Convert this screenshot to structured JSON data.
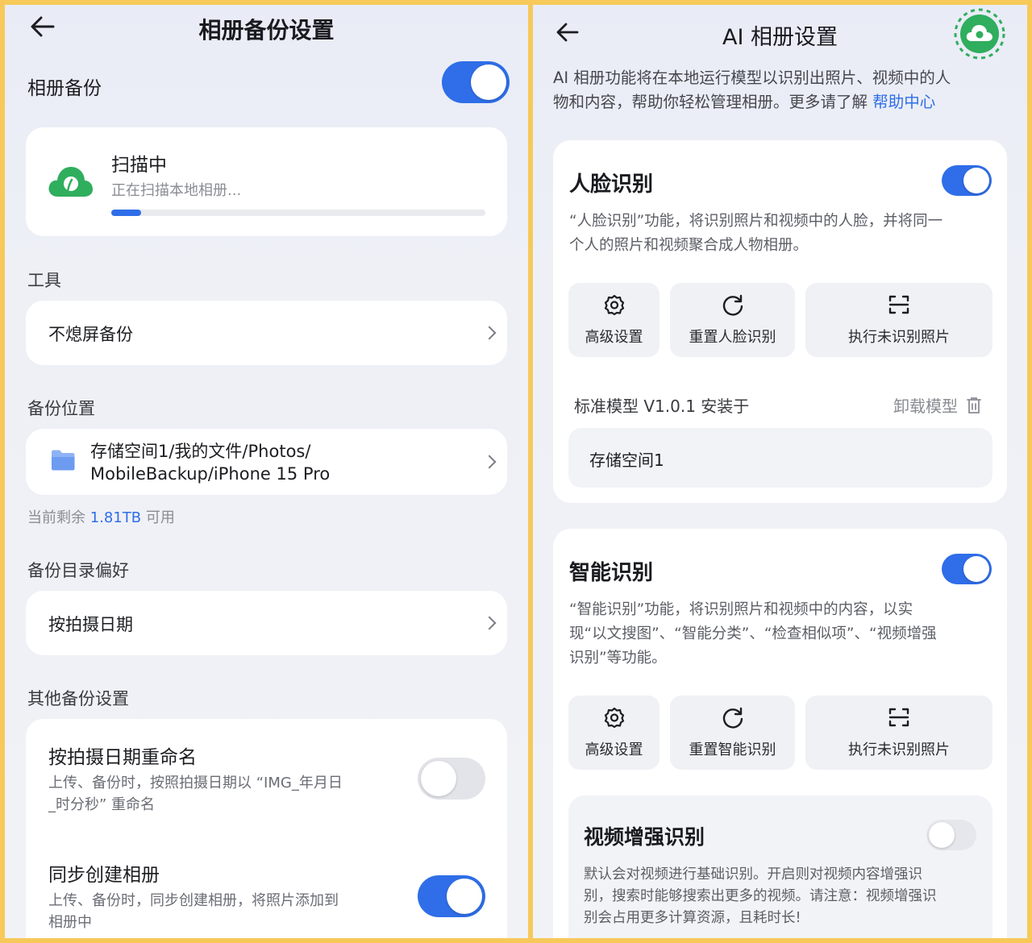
{
  "left": {
    "title": "相册备份设置",
    "backup_label": "相册备份",
    "backup_on": true,
    "scan": {
      "title": "扫描中",
      "subtitle": "正在扫描本地相册...",
      "progress": 0.08
    },
    "tools_label": "工具",
    "tools_row": "不熄屏备份",
    "location_label": "备份位置",
    "location_line1": "存储空间1/我的文件/Photos/",
    "location_line2": "MobileBackup/iPhone 15 Pro",
    "remain_prefix": "当前剩余",
    "remain_value": "1.81TB",
    "remain_suffix": "可用",
    "dir_label": "备份目录偏好",
    "dir_row": "按拍摄日期",
    "other_label": "其他备份设置",
    "rename": {
      "title": "按拍摄日期重命名",
      "desc1": "上传、备份时，按照拍摄日期以 “IMG_年月日",
      "desc2": "_时分秒” 重命名",
      "on": false
    },
    "sync": {
      "title": "同步创建相册",
      "desc1": "上传、备份时，同步创建相册，将照片添加到",
      "desc2": "相册中",
      "on": true
    }
  },
  "right": {
    "title": "AI 相册设置",
    "intro1": "AI 相册功能将在本地运行模型以识别出照片、视频中的人",
    "intro2": "物和内容，帮助你轻松管理相册。更多请了解",
    "help_link": "帮助中心",
    "face": {
      "title": "人脸识别",
      "on": true,
      "desc1": "“人脸识别”功能，将识别照片和视频中的人脸，并将同一",
      "desc2": "个人的照片和视频聚合成人物相册。",
      "actions": [
        "高级设置",
        "重置人脸识别",
        "执行未识别照片"
      ],
      "model": "标准模型 V1.0.1 安装于",
      "uninstall": "卸载模型",
      "storage": "存储空间1"
    },
    "smart": {
      "title": "智能识别",
      "on": true,
      "desc1": "“智能识别”功能，将识别照片和视频中的内容，以实",
      "desc2": "现“以文搜图”、“智能分类”、“检查相似项”、“视频增强",
      "desc3": "识别”等功能。",
      "actions": [
        "高级设置",
        "重置智能识别",
        "执行未识别照片"
      ]
    },
    "video": {
      "title": "视频增强识别",
      "on": false,
      "desc1": "默认会对视频进行基础识别。开启则对视频内容增强识",
      "desc2": "别，搜索时能够搜索出更多的视频。请注意：视频增强识",
      "desc3": "别会占用更多计算资源，且耗时长!"
    }
  },
  "colors": {
    "accent": "#2f6ee8",
    "cloud": "#2fae5d",
    "frame": "#f6c95a"
  }
}
